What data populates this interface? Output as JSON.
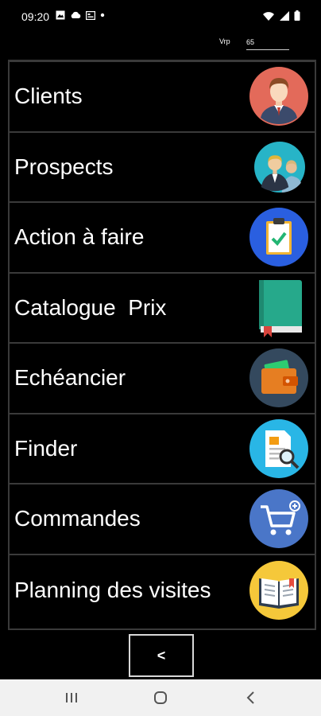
{
  "status_bar": {
    "time": "09:20",
    "left_icons": [
      "image-icon",
      "cloud-icon",
      "card-icon",
      "dot-icon"
    ],
    "right_icons": [
      "wifi-icon",
      "signal-icon",
      "battery-icon"
    ]
  },
  "vrp": {
    "label": "Vrp",
    "value": "65"
  },
  "menu": {
    "items": [
      {
        "label": "Clients",
        "icon": "client-avatar-icon"
      },
      {
        "label": "Prospects",
        "icon": "prospects-people-icon"
      },
      {
        "label": "Action à faire",
        "icon": "clipboard-check-icon"
      },
      {
        "label": "Catalogue  Prix",
        "icon": "book-icon"
      },
      {
        "label": "Echéancier",
        "icon": "wallet-icon"
      },
      {
        "label": "Finder",
        "icon": "document-search-icon"
      },
      {
        "label": "Commandes",
        "icon": "cart-icon"
      },
      {
        "label": "Planning des visites",
        "icon": "open-book-icon"
      }
    ]
  },
  "back_button": {
    "label": "<"
  },
  "nav_bar": {
    "buttons": [
      "recents-icon",
      "home-icon",
      "back-icon"
    ]
  }
}
